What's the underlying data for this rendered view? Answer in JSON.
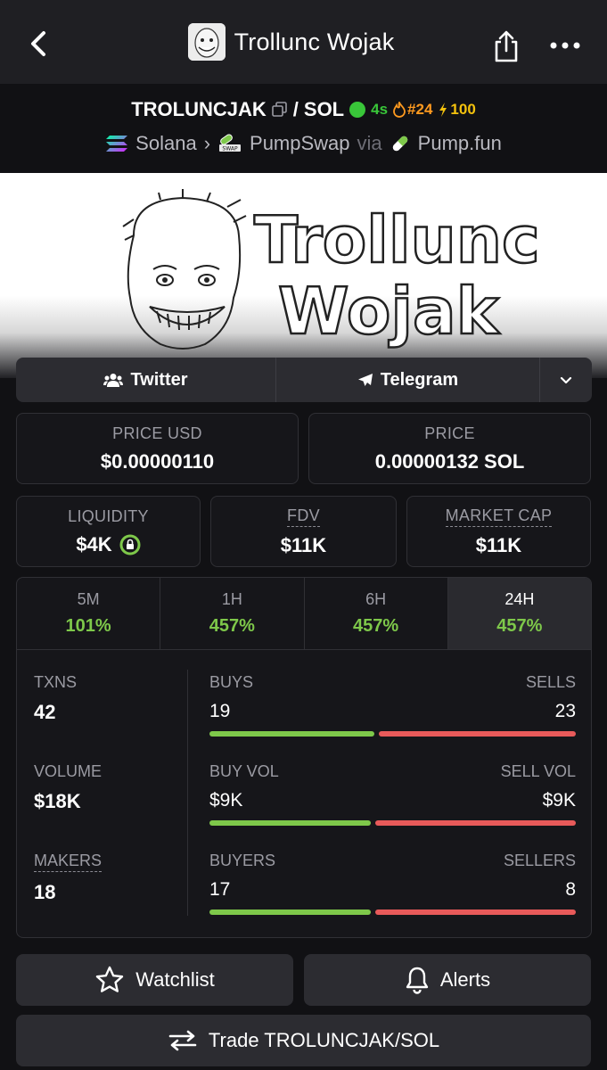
{
  "header": {
    "title": "Trollunc Wojak"
  },
  "pair": {
    "base": "TROLUNCJAK",
    "separator": "/",
    "quote": "SOL",
    "age": "4s",
    "rank": "#24",
    "boost": "100",
    "chain": "Solana",
    "dex": "PumpSwap",
    "via": "via",
    "launchpad": "Pump.fun"
  },
  "banner": {
    "line1": "Trollunc",
    "line2": "Wojak"
  },
  "social": {
    "twitter": "Twitter",
    "telegram": "Telegram"
  },
  "prices": {
    "usd_label": "PRICE USD",
    "usd_value": "$0.00000110",
    "native_label": "PRICE",
    "native_value": "0.00000132 SOL"
  },
  "metrics": {
    "liquidity_label": "LIQUIDITY",
    "liquidity_value": "$4K",
    "fdv_label": "FDV",
    "fdv_value": "$11K",
    "mcap_label": "MARKET CAP",
    "mcap_value": "$11K"
  },
  "timeframes": [
    {
      "label": "5M",
      "value": "101%"
    },
    {
      "label": "1H",
      "value": "457%"
    },
    {
      "label": "6H",
      "value": "457%"
    },
    {
      "label": "24H",
      "value": "457%"
    }
  ],
  "active_timeframe": "24H",
  "stats": {
    "txns_label": "TXNS",
    "txns_value": "42",
    "volume_label": "VOLUME",
    "volume_value": "$18K",
    "makers_label": "MAKERS",
    "makers_value": "18",
    "buys_label": "BUYS",
    "buys_value": "19",
    "sells_label": "SELLS",
    "sells_value": "23",
    "buys_fraction": 0.45,
    "buyvol_label": "BUY VOL",
    "buyvol_value": "$9K",
    "sellvol_label": "SELL VOL",
    "sellvol_value": "$9K",
    "buyvol_fraction": 0.44,
    "buyers_label": "BUYERS",
    "buyers_value": "17",
    "sellers_label": "SELLERS",
    "sellers_value": "8",
    "buyers_fraction": 0.44
  },
  "actions": {
    "watchlist": "Watchlist",
    "alerts": "Alerts",
    "trade": "Trade TROLUNCJAK/SOL"
  },
  "colors": {
    "positive": "#7ec84a",
    "negative": "#e85a5a",
    "background": "#111114",
    "card": "#16161a"
  }
}
